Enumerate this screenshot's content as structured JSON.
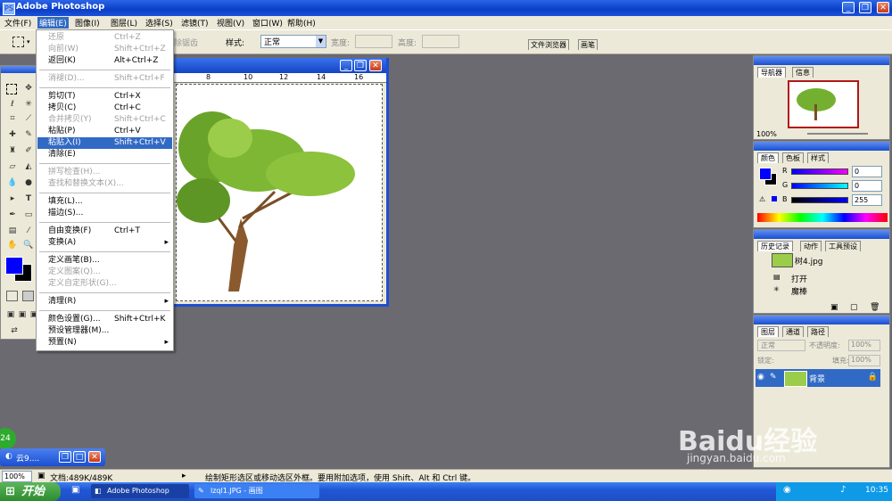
{
  "app": {
    "title": "Adobe Photoshop"
  },
  "menubar": [
    {
      "label": "文件(F)"
    },
    {
      "label": "编辑(E)"
    },
    {
      "label": "图像(I)"
    },
    {
      "label": "图层(L)"
    },
    {
      "label": "选择(S)"
    },
    {
      "label": "滤镜(T)"
    },
    {
      "label": "视图(V)"
    },
    {
      "label": "窗口(W)"
    },
    {
      "label": "帮助(H)"
    }
  ],
  "options_bar": {
    "clear_label": "除锯齿",
    "style_label": "样式:",
    "style_value": "正常",
    "width_label": "宽度:",
    "height_label": "高度:",
    "tab_file_browser": "文件浏览器",
    "tab_brushes": "画笔"
  },
  "edit_menu": {
    "group1": [
      {
        "label": "还原",
        "shortcut": "Ctrl+Z",
        "disabled": true
      },
      {
        "label": "向前(W)",
        "shortcut": "Shift+Ctrl+Z",
        "disabled": true
      },
      {
        "label": "返回(K)",
        "shortcut": "Alt+Ctrl+Z",
        "disabled": false
      }
    ],
    "group2": [
      {
        "label": "消褪(D)...",
        "shortcut": "Shift+Ctrl+F",
        "disabled": true
      }
    ],
    "group3": [
      {
        "label": "剪切(T)",
        "shortcut": "Ctrl+X",
        "disabled": false
      },
      {
        "label": "拷贝(C)",
        "shortcut": "Ctrl+C",
        "disabled": false
      },
      {
        "label": "合并拷贝(Y)",
        "shortcut": "Shift+Ctrl+C",
        "disabled": true
      },
      {
        "label": "粘贴(P)",
        "shortcut": "Ctrl+V",
        "disabled": false
      },
      {
        "label": "粘贴入(I)",
        "shortcut": "Shift+Ctrl+V",
        "disabled": false,
        "highlighted": true
      },
      {
        "label": "清除(E)",
        "shortcut": "",
        "disabled": false
      }
    ],
    "group4": [
      {
        "label": "拼写检查(H)...",
        "shortcut": "",
        "disabled": true
      },
      {
        "label": "查找和替换文本(X)...",
        "shortcut": "",
        "disabled": true
      }
    ],
    "group5": [
      {
        "label": "填充(L)...",
        "shortcut": "",
        "disabled": false
      },
      {
        "label": "描边(S)...",
        "shortcut": "",
        "disabled": false
      }
    ],
    "group6": [
      {
        "label": "自由变换(F)",
        "shortcut": "Ctrl+T",
        "disabled": false
      },
      {
        "label": "变换(A)",
        "shortcut": "",
        "disabled": false,
        "submenu": true
      }
    ],
    "group7": [
      {
        "label": "定义画笔(B)...",
        "shortcut": "",
        "disabled": false
      },
      {
        "label": "定义图案(Q)...",
        "shortcut": "",
        "disabled": true
      },
      {
        "label": "定义自定形状(G)...",
        "shortcut": "",
        "disabled": true
      }
    ],
    "group8": [
      {
        "label": "清理(R)",
        "shortcut": "",
        "disabled": false,
        "submenu": true
      }
    ],
    "group9": [
      {
        "label": "颜色设置(G)...",
        "shortcut": "Shift+Ctrl+K",
        "disabled": false
      },
      {
        "label": "预设管理器(M)...",
        "shortcut": "",
        "disabled": false
      },
      {
        "label": "预置(N)",
        "shortcut": "",
        "disabled": false,
        "submenu": true
      }
    ]
  },
  "document": {
    "ruler_ticks": [
      "8",
      "10",
      "12",
      "14",
      "16"
    ]
  },
  "navigator": {
    "tabs": [
      "导航器",
      "信息"
    ],
    "zoom": "100%"
  },
  "color_palette": {
    "tabs": [
      "颜色",
      "色板",
      "样式"
    ],
    "channels": [
      {
        "label": "R",
        "value": "0"
      },
      {
        "label": "G",
        "value": "0"
      },
      {
        "label": "B",
        "value": "255"
      }
    ],
    "foreground_color": "#0000ff",
    "background_color": "#000000"
  },
  "history": {
    "tabs": [
      "历史记录",
      "动作",
      "工具预设"
    ],
    "snapshot": "树4.jpg",
    "items": [
      "打开",
      "魔棒"
    ]
  },
  "layers": {
    "tabs": [
      "图层",
      "通道",
      "路径"
    ],
    "blend_mode": "正常",
    "opacity_label": "不透明度:",
    "opacity": "100%",
    "lock_label": "锁定:",
    "fill_label": "填充:",
    "fill": "100%",
    "layer_name": "背景"
  },
  "minimized_doc": {
    "title": "云9...."
  },
  "status_bar": {
    "zoom": "100%",
    "doc_size": "文档:489K/489K",
    "hint": "绘制矩形选区或移动选区外框。要用附加选项，使用 Shift、Alt 和 Ctrl 键。"
  },
  "taskbar": {
    "start": "开始",
    "tasks": [
      "Adobe Photoshop",
      "lzql1.JPG - 画图"
    ],
    "clock": "10:35"
  },
  "badge_number": "24",
  "watermark": {
    "text": "Baidu经验",
    "url": "jingyan.baidu.com"
  }
}
